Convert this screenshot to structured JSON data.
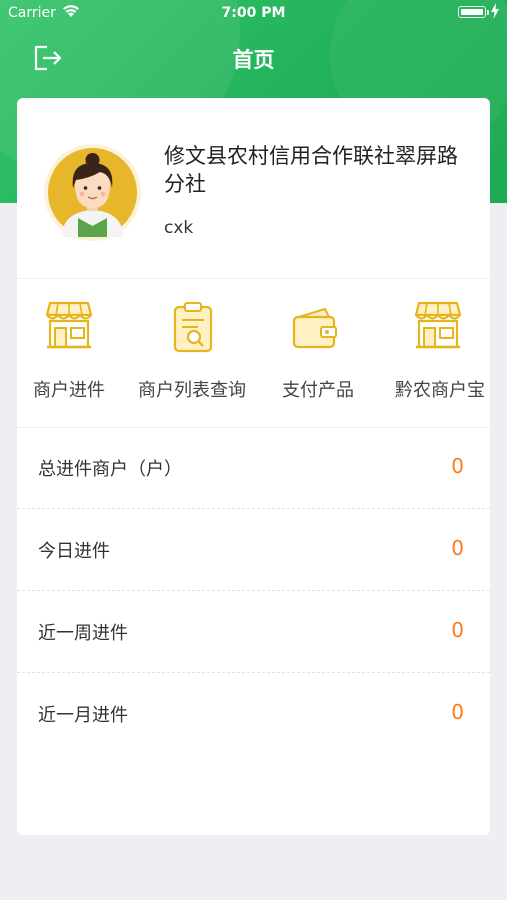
{
  "status_bar": {
    "carrier": "Carrier",
    "time": "7:00 PM"
  },
  "nav": {
    "title": "首页"
  },
  "profile": {
    "org_name": "修文县农村信用合作联社翠屏路分社",
    "user_name": "cxk"
  },
  "quick_actions": [
    {
      "label": "商户进件",
      "icon": "storefront-icon"
    },
    {
      "label": "商户列表查询",
      "icon": "clipboard-search-icon"
    },
    {
      "label": "支付产品",
      "icon": "wallet-icon"
    },
    {
      "label": "黔农商户宝",
      "icon": "storefront-icon"
    }
  ],
  "stats": [
    {
      "label": "总进件商户（户）",
      "value": "0"
    },
    {
      "label": "今日进件",
      "value": "0"
    },
    {
      "label": "近一周进件",
      "value": "0"
    },
    {
      "label": "近一月进件",
      "value": "0"
    }
  ],
  "colors": {
    "header_green": "#22b25a",
    "icon_gold": "#e6b41c",
    "value_orange": "#ff7a1a"
  }
}
